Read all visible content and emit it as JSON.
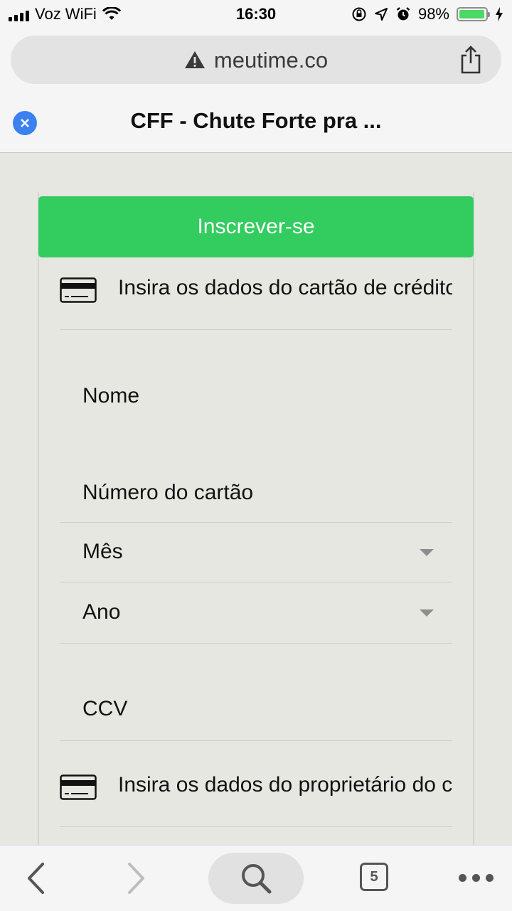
{
  "status_bar": {
    "carrier": "Voz WiFi",
    "time": "16:30",
    "battery_percent_text": "98%",
    "battery_level": 0.98,
    "icons": [
      "signal-icon",
      "wifi-icon",
      "orientation-lock-icon",
      "location-icon",
      "alarm-icon",
      "battery-icon",
      "charging-icon"
    ]
  },
  "browser": {
    "url": "meutime.co",
    "url_warning_icon": "warning-icon",
    "share_icon": "share-icon",
    "page_title": "CFF - Chute Forte pra ...",
    "close_icon": "close-icon"
  },
  "form": {
    "subscribe_button": "Inscrever-se",
    "card_section_text": "Insira os dados do cartão de crédito",
    "fields": {
      "name": "Nome",
      "card_number": "Número do cartão",
      "month": "Mês",
      "year": "Ano",
      "ccv": "CCV"
    },
    "owner_section_text": "Insira os dados do proprietário do cartão"
  },
  "toolbar": {
    "back_icon": "back-icon",
    "forward_icon": "forward-icon",
    "search_icon": "search-icon",
    "tab_count": "5",
    "more_icon": "more-icon"
  },
  "colors": {
    "accent_green": "#33cc5f",
    "close_blue": "#3b82f0",
    "battery_green": "#4cd964"
  }
}
